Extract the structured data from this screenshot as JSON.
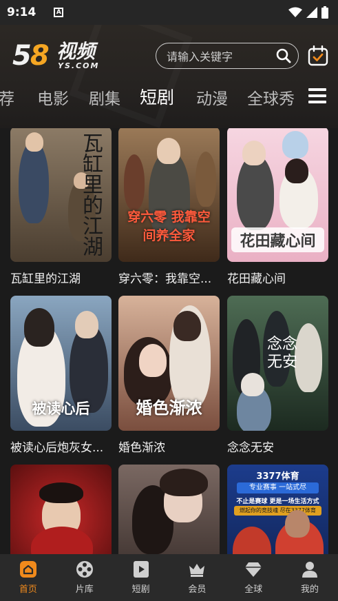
{
  "status": {
    "time": "9:14",
    "notif_letter": "A"
  },
  "header": {
    "logo_number": "58",
    "logo_cn": "视频",
    "logo_en": "YS.COM",
    "search_placeholder": "请输入关键字"
  },
  "tabs": [
    {
      "label": "荐",
      "active": false
    },
    {
      "label": "电影",
      "active": false
    },
    {
      "label": "剧集",
      "active": false
    },
    {
      "label": "短剧",
      "active": true
    },
    {
      "label": "动漫",
      "active": false
    },
    {
      "label": "全球秀",
      "active": false
    }
  ],
  "cards": [
    {
      "title": "瓦缸里的江湖",
      "poster_text": "瓦缸里的江湖",
      "bg": [
        "#6b5a48",
        "#3c3228"
      ]
    },
    {
      "title": "穿六零：我靠空间养全家",
      "title_display": "穿六零：我靠空...",
      "poster_text": "穿六零 我靠空间养全家",
      "bg": [
        "#7a4a2c",
        "#3a2418"
      ]
    },
    {
      "title": "花田藏心间",
      "poster_text": "花田藏心间",
      "bg": [
        "#f3c9d6",
        "#e9a9bf"
      ]
    },
    {
      "title": "被读心后炮灰女配竟然成了万人迷",
      "title_display": "被读心后炮灰女...",
      "poster_text": "被读心后",
      "bg": [
        "#6e8aa4",
        "#2f3f54"
      ]
    },
    {
      "title": "婚色渐浓",
      "poster_text": "婚色渐浓",
      "bg": [
        "#c4957a",
        "#6b4436"
      ]
    },
    {
      "title": "念念无安",
      "poster_text": "念念无安",
      "bg": [
        "#3e5a44",
        "#1f2e24"
      ]
    },
    {
      "title": "",
      "poster_text": "",
      "bg": [
        "#a81c1c",
        "#3a0c0c"
      ]
    },
    {
      "title": "",
      "poster_text": "",
      "bg": [
        "#5a4a44",
        "#2a2220"
      ]
    },
    {
      "title": "",
      "poster_text": "3377体育",
      "bg": [
        "#1c3c8c",
        "#0f1f4a"
      ]
    }
  ],
  "ad_card": {
    "brand": "3377体育",
    "line1": "专业赛事 一站式尽",
    "line2": "不止是赛球 更是一场生活方式",
    "line3": "燃起你的竞技魂 尽在3377体育"
  },
  "bottom_nav": [
    {
      "label": "首页",
      "icon": "home-icon",
      "active": true
    },
    {
      "label": "片库",
      "icon": "film-reel-icon",
      "active": false
    },
    {
      "label": "短剧",
      "icon": "play-icon",
      "active": false
    },
    {
      "label": "会员",
      "icon": "crown-icon",
      "active": false
    },
    {
      "label": "全球",
      "icon": "diamond-icon",
      "active": false
    },
    {
      "label": "我的",
      "icon": "person-icon",
      "active": false
    }
  ],
  "colors": {
    "accent": "#f08a1c",
    "bg": "#1b1b1b",
    "nav_bg": "#2a2a2a"
  }
}
